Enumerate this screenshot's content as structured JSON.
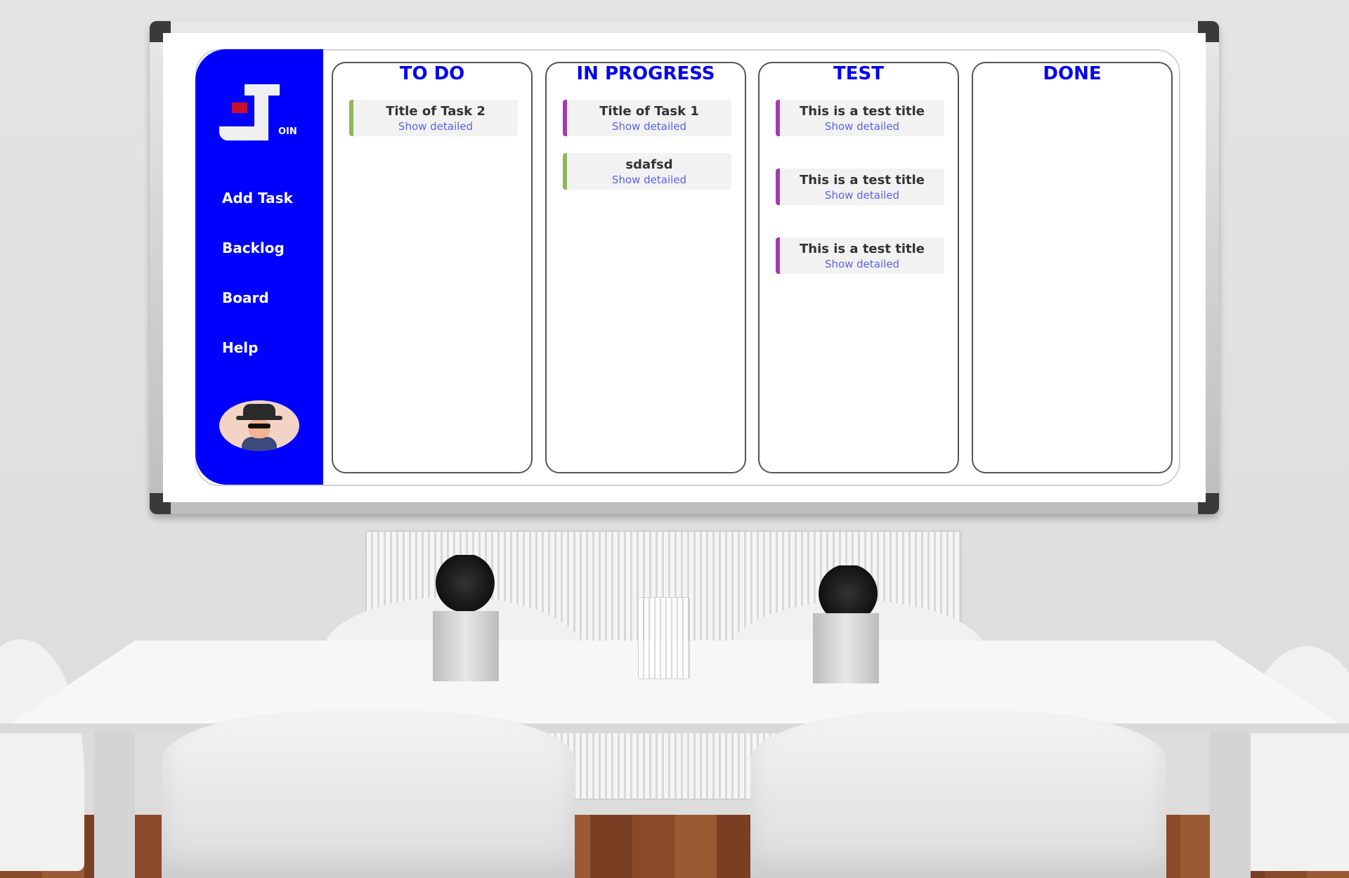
{
  "app": {
    "logo_text": "OIN",
    "accent_color": "#0000ff",
    "logo_mark_color": "#c8102e"
  },
  "sidebar": {
    "items": [
      {
        "label": "Add Task"
      },
      {
        "label": "Backlog"
      },
      {
        "label": "Board"
      },
      {
        "label": "Help"
      }
    ]
  },
  "board": {
    "show_link_label": "Show detailed",
    "columns": [
      {
        "title": "TO DO",
        "cards": [
          {
            "title": "Title of Task 2",
            "show": "Show detailed",
            "priority_color": "#8db85b"
          }
        ]
      },
      {
        "title": "IN PROGRESS",
        "cards": [
          {
            "title": "Title of Task 1",
            "show": "Show detailed",
            "priority_color": "#a43ab0"
          },
          {
            "title": "sdafsd",
            "show": "Show detailed",
            "priority_color": "#8db85b"
          }
        ]
      },
      {
        "title": "TEST",
        "cards": [
          {
            "title": "This is a test title",
            "show": "Show detailed",
            "priority_color": "#a43ab0"
          },
          {
            "title": "This is a test title",
            "show": "Show detailed",
            "priority_color": "#a43ab0"
          },
          {
            "title": "This is a test title",
            "show": "Show detailed",
            "priority_color": "#a43ab0"
          }
        ]
      },
      {
        "title": "DONE",
        "cards": []
      }
    ]
  }
}
